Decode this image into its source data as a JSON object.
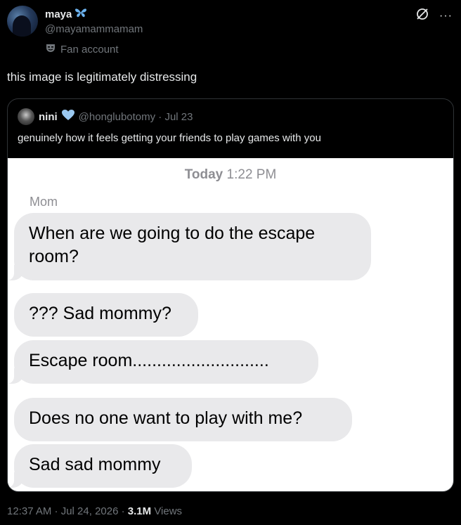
{
  "tweet": {
    "author": {
      "display_name": "maya",
      "handle": "@mayamammamam",
      "affiliation": "Fan account"
    },
    "text": "this image is legitimately distressing",
    "timestamp": "12:37 AM · Jul 24, 2026 ·",
    "views_count": "3.1M",
    "views_label": "Views"
  },
  "quote": {
    "author_name": "nini",
    "handle_date": "@honglubotomy · Jul 23",
    "text": "genuinely how it feels getting your friends to play games with you"
  },
  "imessage": {
    "day": "Today",
    "time": "1:22 PM",
    "sender": "Mom",
    "messages": [
      "When are we going to do the escape room?",
      "??? Sad mommy?",
      "Escape room............................",
      "Does no one want to play with me?",
      "Sad sad mommy"
    ]
  },
  "colors": {
    "background": "#000000",
    "text": "#e7e9ea",
    "muted": "#71767b",
    "bubble": "#e9e9eb",
    "verified_heart": "#9ac8f0"
  },
  "icons": [
    "butterfly-icon",
    "mask-icon",
    "grok-icon",
    "more-icon",
    "heart-icon"
  ]
}
